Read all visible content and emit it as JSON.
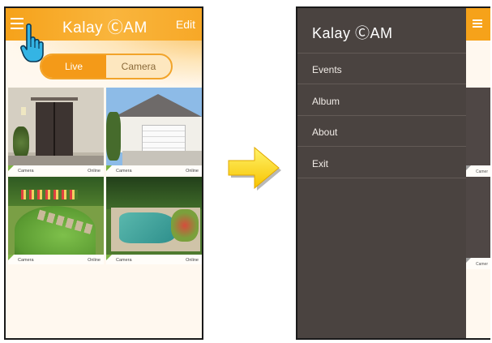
{
  "left_screen": {
    "brand": "Kalay ⒸAM",
    "edit_label": "Edit",
    "tabs": [
      {
        "label": "Live",
        "active": true
      },
      {
        "label": "Camera",
        "active": false
      }
    ],
    "cameras": [
      {
        "name": "Camera",
        "status": "Online"
      },
      {
        "name": "Camera",
        "status": "Online"
      },
      {
        "name": "Camera",
        "status": "Online"
      },
      {
        "name": "Camera",
        "status": "Online"
      }
    ]
  },
  "right_screen": {
    "brand": "Kalay ⒸAM",
    "menu_items": [
      {
        "label": "Events"
      },
      {
        "label": "Album"
      },
      {
        "label": "About"
      },
      {
        "label": "Exit"
      }
    ],
    "behind_captions": [
      "Camer",
      "Camer"
    ]
  },
  "colors": {
    "accent": "#f6a21a",
    "drawer_bg": "#4a4340",
    "online_marker": "#7cb342",
    "arrow": "#ffd21a"
  },
  "icons": {
    "menu": "hamburger-menu-icon",
    "pointer": "pointing-hand-cursor-icon",
    "transition": "right-arrow-icon"
  }
}
